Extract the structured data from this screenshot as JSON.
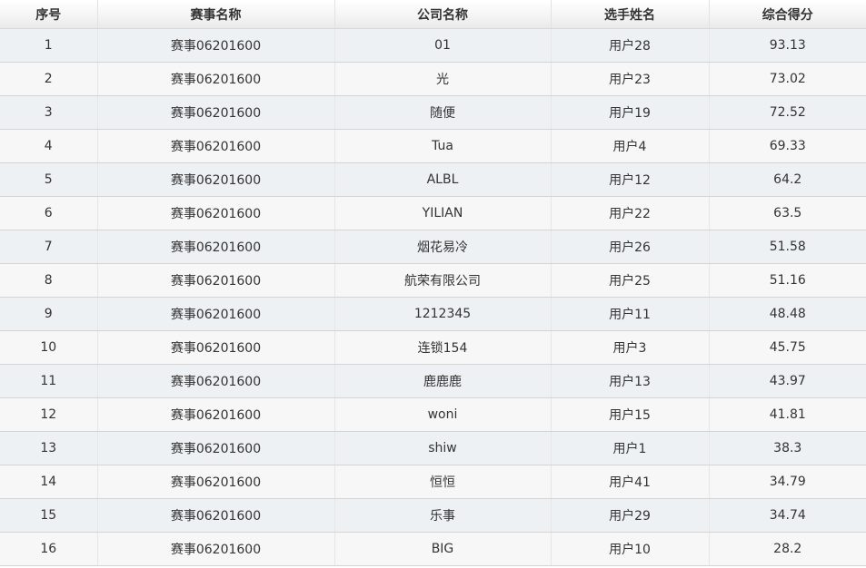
{
  "table": {
    "headers": [
      "序号",
      "赛事名称",
      "公司名称",
      "选手姓名",
      "综合得分"
    ],
    "rows": [
      [
        "1",
        "赛事06201600",
        "01",
        "用户28",
        "93.13"
      ],
      [
        "2",
        "赛事06201600",
        "光",
        "用户23",
        "73.02"
      ],
      [
        "3",
        "赛事06201600",
        "随便",
        "用户19",
        "72.52"
      ],
      [
        "4",
        "赛事06201600",
        "Tua",
        "用户4",
        "69.33"
      ],
      [
        "5",
        "赛事06201600",
        "ALBL",
        "用户12",
        "64.2"
      ],
      [
        "6",
        "赛事06201600",
        "YILIAN",
        "用户22",
        "63.5"
      ],
      [
        "7",
        "赛事06201600",
        "烟花易冷",
        "用户26",
        "51.58"
      ],
      [
        "8",
        "赛事06201600",
        "航荣有限公司",
        "用户25",
        "51.16"
      ],
      [
        "9",
        "赛事06201600",
        "1212345",
        "用户11",
        "48.48"
      ],
      [
        "10",
        "赛事06201600",
        "连锁154",
        "用户3",
        "45.75"
      ],
      [
        "11",
        "赛事06201600",
        "鹿鹿鹿",
        "用户13",
        "43.97"
      ],
      [
        "12",
        "赛事06201600",
        "woni",
        "用户15",
        "41.81"
      ],
      [
        "13",
        "赛事06201600",
        "shiw",
        "用户1",
        "38.3"
      ],
      [
        "14",
        "赛事06201600",
        "恒恒",
        "用户41",
        "34.79"
      ],
      [
        "15",
        "赛事06201600",
        "乐事",
        "用户29",
        "34.74"
      ],
      [
        "16",
        "赛事06201600",
        "BIG",
        "用户10",
        "28.2"
      ]
    ]
  }
}
